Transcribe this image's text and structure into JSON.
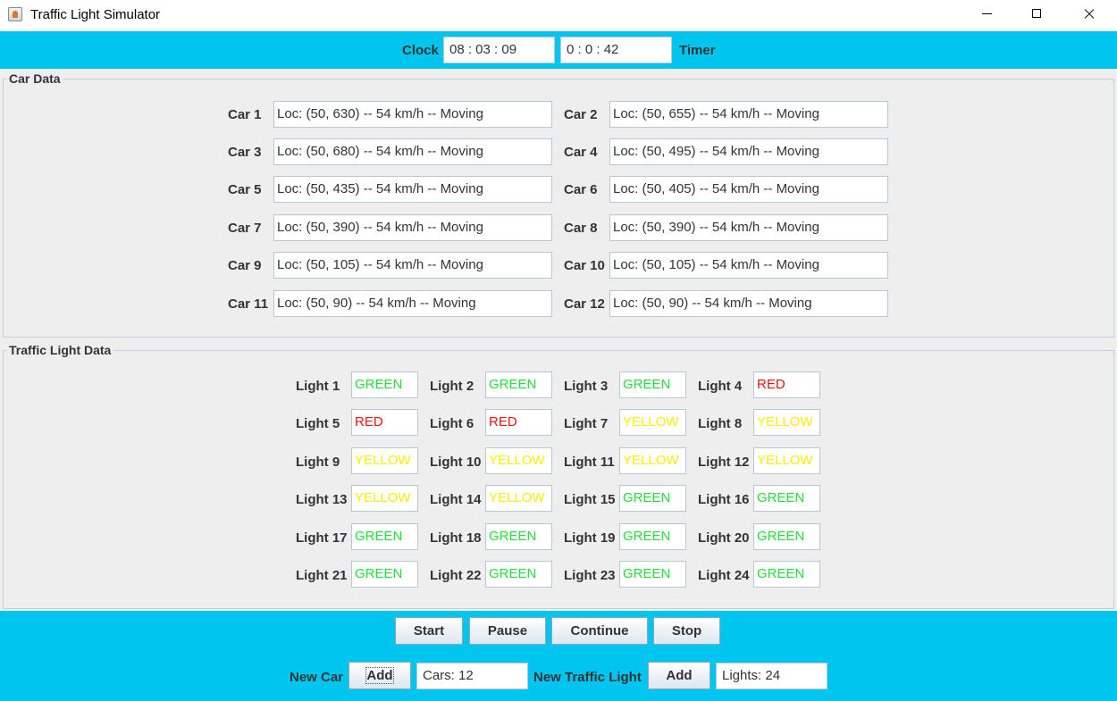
{
  "window": {
    "title": "Traffic Light Simulator"
  },
  "top": {
    "clock_label": "Clock",
    "clock_value": "08 : 03 : 09",
    "timer_value": "0 : 0 : 42",
    "timer_label": "Timer"
  },
  "car_panel": {
    "title": "Car Data",
    "cars": [
      {
        "label": "Car 1",
        "value": "Loc: (50, 630) -- 54 km/h -- Moving"
      },
      {
        "label": "Car 2",
        "value": "Loc: (50, 655) -- 54 km/h -- Moving"
      },
      {
        "label": "Car 3",
        "value": "Loc: (50, 680) -- 54 km/h -- Moving"
      },
      {
        "label": "Car 4",
        "value": "Loc: (50, 495) -- 54 km/h -- Moving"
      },
      {
        "label": "Car 5",
        "value": "Loc: (50, 435) -- 54 km/h -- Moving"
      },
      {
        "label": "Car 6",
        "value": "Loc: (50, 405) -- 54 km/h -- Moving"
      },
      {
        "label": "Car 7",
        "value": "Loc: (50, 390) -- 54 km/h -- Moving"
      },
      {
        "label": "Car 8",
        "value": "Loc: (50, 390) -- 54 km/h -- Moving"
      },
      {
        "label": "Car 9",
        "value": "Loc: (50, 105) -- 54 km/h -- Moving"
      },
      {
        "label": "Car 10",
        "value": "Loc: (50, 105) -- 54 km/h -- Moving"
      },
      {
        "label": "Car 11",
        "value": "Loc: (50, 90) -- 54 km/h -- Moving"
      },
      {
        "label": "Car 12",
        "value": "Loc: (50, 90) -- 54 km/h -- Moving"
      }
    ]
  },
  "light_panel": {
    "title": "Traffic Light Data",
    "lights": [
      {
        "label": "Light 1",
        "value": "GREEN"
      },
      {
        "label": "Light 2",
        "value": "GREEN"
      },
      {
        "label": "Light 3",
        "value": "GREEN"
      },
      {
        "label": "Light 4",
        "value": "RED"
      },
      {
        "label": "Light 5",
        "value": "RED"
      },
      {
        "label": "Light 6",
        "value": "RED"
      },
      {
        "label": "Light 7",
        "value": "YELLOW"
      },
      {
        "label": "Light 8",
        "value": "YELLOW"
      },
      {
        "label": "Light 9",
        "value": "YELLOW"
      },
      {
        "label": "Light 10",
        "value": "YELLOW"
      },
      {
        "label": "Light 11",
        "value": "YELLOW"
      },
      {
        "label": "Light 12",
        "value": "YELLOW"
      },
      {
        "label": "Light 13",
        "value": "YELLOW"
      },
      {
        "label": "Light 14",
        "value": "YELLOW"
      },
      {
        "label": "Light 15",
        "value": "GREEN"
      },
      {
        "label": "Light 16",
        "value": "GREEN"
      },
      {
        "label": "Light 17",
        "value": "GREEN"
      },
      {
        "label": "Light 18",
        "value": "GREEN"
      },
      {
        "label": "Light 19",
        "value": "GREEN"
      },
      {
        "label": "Light 20",
        "value": "GREEN"
      },
      {
        "label": "Light 21",
        "value": "GREEN"
      },
      {
        "label": "Light 22",
        "value": "GREEN"
      },
      {
        "label": "Light 23",
        "value": "GREEN"
      },
      {
        "label": "Light 24",
        "value": "GREEN"
      }
    ]
  },
  "controls": {
    "start": "Start",
    "pause": "Pause",
    "continue": "Continue",
    "stop": "Stop"
  },
  "bottom": {
    "new_car_label": "New Car",
    "add_car": "Add",
    "cars_count": "Cars: 12",
    "new_light_label": "New Traffic Light",
    "add_light": "Add",
    "lights_count": "Lights: 24"
  },
  "colors": {
    "accent_bar": "#00c6ef",
    "GREEN": "#22e03a",
    "RED": "#ee1111",
    "YELLOW": "#ffee00"
  }
}
